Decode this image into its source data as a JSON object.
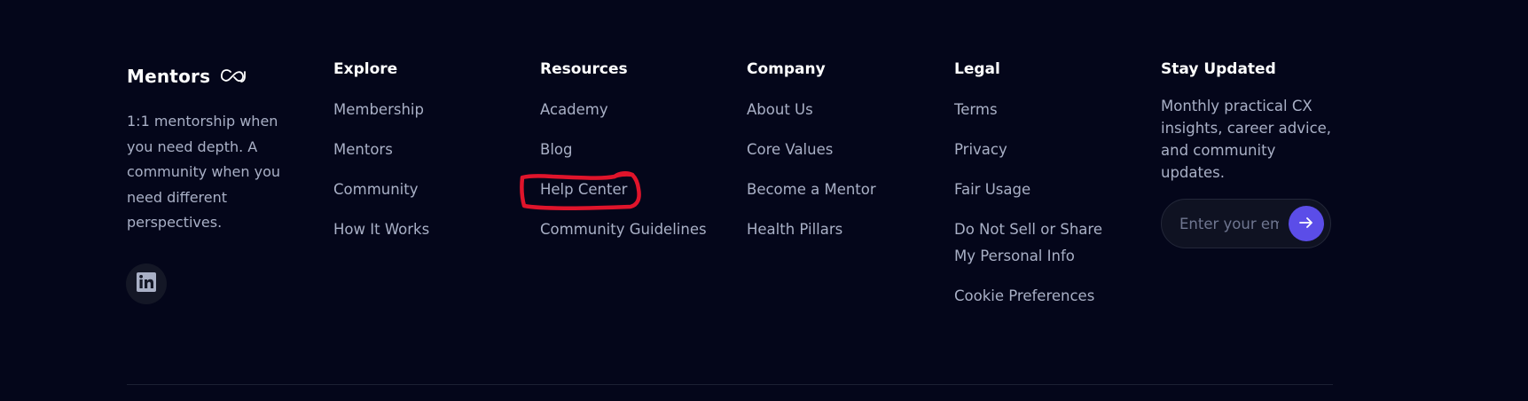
{
  "brand": {
    "name": "Mentors",
    "logo_icon": "infinity-cx-logo-icon",
    "tagline": "1:1 mentorship when you need depth. A community when you need different perspectives.",
    "social": [
      {
        "name": "linkedin",
        "icon": "linkedin-icon"
      }
    ]
  },
  "columns": {
    "explore": {
      "heading": "Explore",
      "links": [
        "Membership",
        "Mentors",
        "Community",
        "How It Works"
      ]
    },
    "resources": {
      "heading": "Resources",
      "links": [
        "Academy",
        "Blog",
        "Help Center",
        "Community Guidelines"
      ]
    },
    "company": {
      "heading": "Company",
      "links": [
        "About Us",
        "Core Values",
        "Become a Mentor",
        "Health Pillars"
      ]
    },
    "legal": {
      "heading": "Legal",
      "links": [
        "Terms",
        "Privacy",
        "Fair Usage",
        "Do Not Sell or Share My Personal Info",
        "Cookie Preferences"
      ]
    }
  },
  "newsletter": {
    "heading": "Stay Updated",
    "description": "Monthly practical CX insights, career advice, and community updates.",
    "email_placeholder": "Enter your email",
    "email_value": "",
    "submit_icon": "arrow-right-icon"
  },
  "annotation": {
    "type": "red-hand-drawn-outline",
    "target": "Help Center",
    "color": "#e0142b"
  },
  "colors": {
    "background": "#04061a",
    "heading": "#ffffff",
    "link": "#a9b0c6",
    "accent": "#5b4de8",
    "annotation": "#e0142b"
  }
}
